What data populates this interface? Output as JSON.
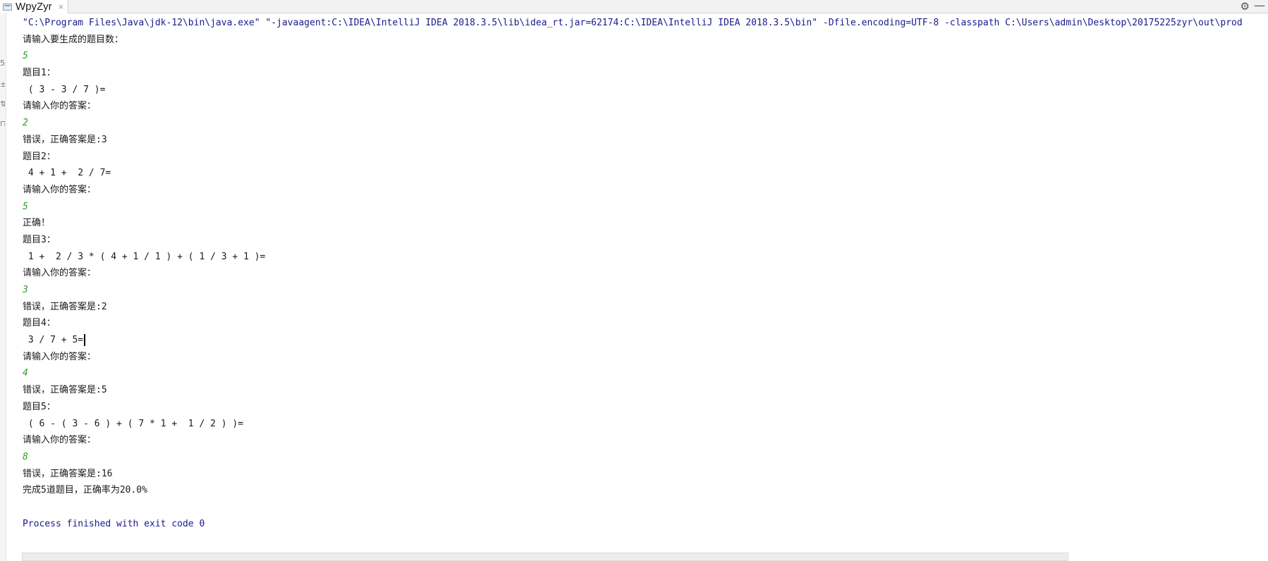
{
  "tab": {
    "title": "WpyZyr",
    "close_glyph": "×"
  },
  "toolbar": {
    "settings_glyph": "⚙",
    "minimize_glyph": "—"
  },
  "console": {
    "lines": [
      {
        "kind": "cmd",
        "text": "\"C:\\Program Files\\Java\\jdk-12\\bin\\java.exe\" \"-javaagent:C:\\IDEA\\IntelliJ IDEA 2018.3.5\\lib\\idea_rt.jar=62174:C:\\IDEA\\IntelliJ IDEA 2018.3.5\\bin\" -Dfile.encoding=UTF-8 -classpath C:\\Users\\admin\\Desktop\\20175225zyr\\out\\prod"
      },
      {
        "kind": "output",
        "text": "请输入要生成的题目数："
      },
      {
        "kind": "input",
        "text": "5"
      },
      {
        "kind": "output",
        "text": "题目1："
      },
      {
        "kind": "output",
        "text": " ( 3 - 3 / 7 )="
      },
      {
        "kind": "output",
        "text": "请输入你的答案："
      },
      {
        "kind": "input",
        "text": "2"
      },
      {
        "kind": "output",
        "text": "错误，正确答案是:3"
      },
      {
        "kind": "output",
        "text": "题目2："
      },
      {
        "kind": "output",
        "text": " 4 + 1 +  2 / 7="
      },
      {
        "kind": "output",
        "text": "请输入你的答案："
      },
      {
        "kind": "input",
        "text": "5"
      },
      {
        "kind": "output",
        "text": "正确！"
      },
      {
        "kind": "output",
        "text": "题目3："
      },
      {
        "kind": "output",
        "text": " 1 +  2 / 3 * ( 4 + 1 / 1 ) + ( 1 / 3 + 1 )="
      },
      {
        "kind": "output",
        "text": "请输入你的答案："
      },
      {
        "kind": "input",
        "text": "3"
      },
      {
        "kind": "output",
        "text": "错误，正确答案是:2"
      },
      {
        "kind": "output",
        "text": "题目4："
      },
      {
        "kind": "output",
        "text": " 3 / 7 + 5=",
        "caret": true
      },
      {
        "kind": "output",
        "text": "请输入你的答案："
      },
      {
        "kind": "input",
        "text": "4"
      },
      {
        "kind": "output",
        "text": "错误，正确答案是:5"
      },
      {
        "kind": "output",
        "text": "题目5："
      },
      {
        "kind": "output",
        "text": " ( 6 - ( 3 - 6 ) + ( 7 * 1 +  1 / 2 ) )="
      },
      {
        "kind": "output",
        "text": "请输入你的答案："
      },
      {
        "kind": "input",
        "text": "8"
      },
      {
        "kind": "output",
        "text": "错误，正确答案是:16"
      },
      {
        "kind": "output",
        "text": "完成5道题目，正确率为20.0%"
      },
      {
        "kind": "blank",
        "text": ""
      },
      {
        "kind": "process",
        "text": "Process finished with exit code 0"
      }
    ]
  },
  "gutter": {
    "marks": [
      "5",
      "±",
      "⇅",
      "⊓"
    ]
  }
}
